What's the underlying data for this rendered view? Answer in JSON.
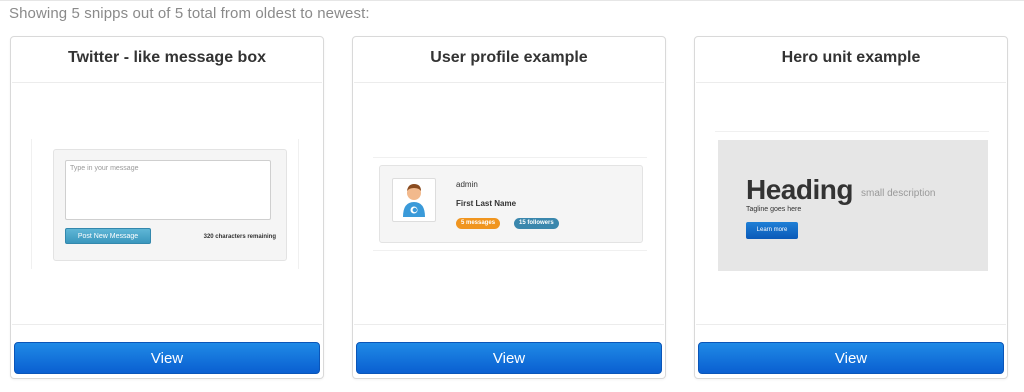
{
  "summary": "Showing 5 snipps out of 5 total from oldest to newest:",
  "cards": [
    {
      "title": "Twitter - like message box",
      "view_label": "View",
      "preview": {
        "placeholder": "Type in your message",
        "post_label": "Post New Message",
        "remaining": "320 characters remaining"
      }
    },
    {
      "title": "User profile example",
      "view_label": "View",
      "preview": {
        "username": "admin",
        "full_name": "First Last Name",
        "messages_badge": "5 messages",
        "followers_badge": "15 followers"
      }
    },
    {
      "title": "Hero unit example",
      "view_label": "View",
      "preview": {
        "heading": "Heading",
        "small_description": "small description",
        "tagline": "Tagline goes here",
        "button_label": "Learn more"
      }
    }
  ],
  "colors": {
    "view_button": "#0a5fd1",
    "messages_badge": "#f0951f",
    "followers_badge": "#3a87ad"
  }
}
